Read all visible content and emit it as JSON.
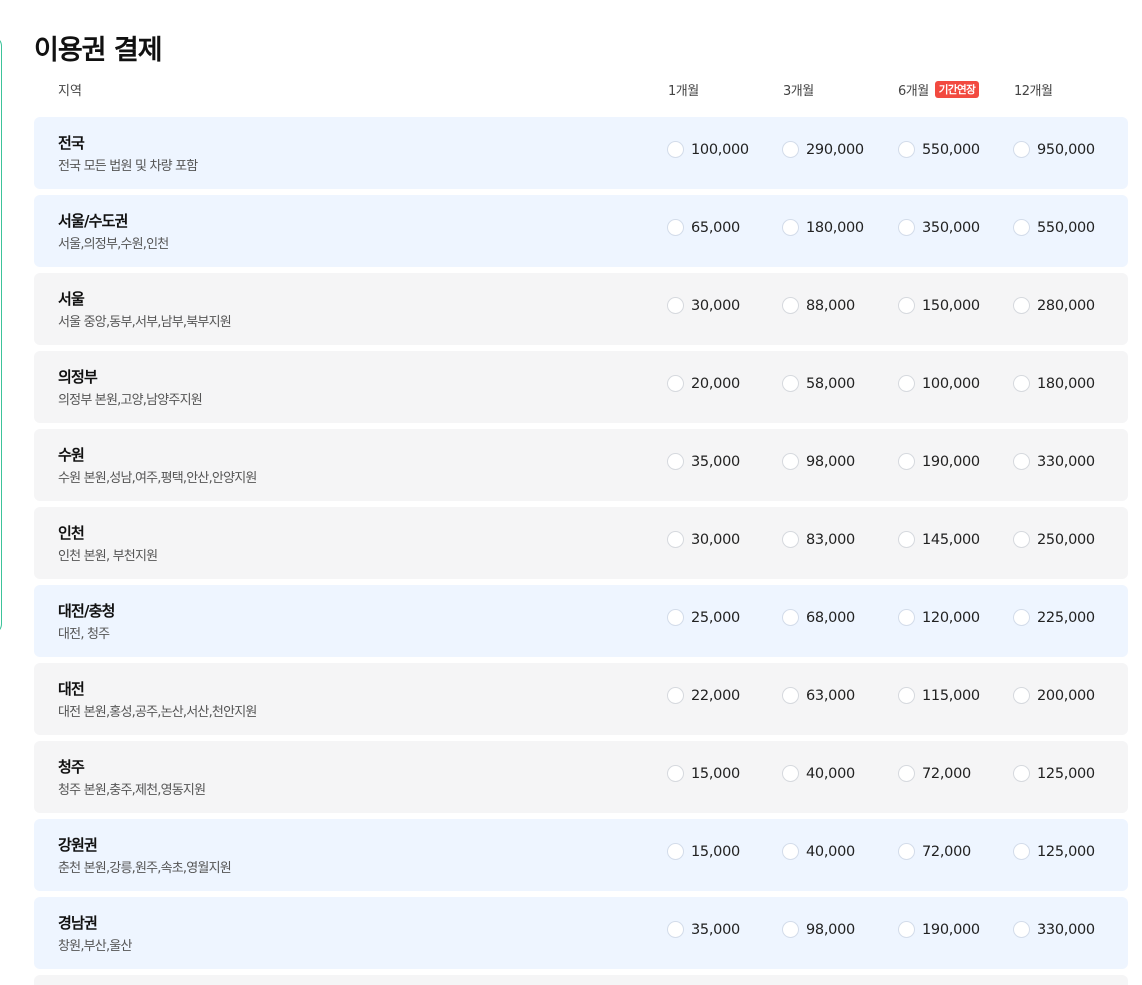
{
  "page": {
    "title": "이용권 결제"
  },
  "columns": {
    "region": "지역",
    "periods": [
      "1개월",
      "3개월",
      "6개월",
      "12개월"
    ],
    "badge": "기간연장"
  },
  "rows": [
    {
      "name": "전국",
      "desc": "전국 모든 법원 및 차량 포함",
      "prices": [
        "100,000",
        "290,000",
        "550,000",
        "950,000"
      ],
      "highlight": true
    },
    {
      "name": "서울/수도권",
      "desc": "서울,의정부,수원,인천",
      "prices": [
        "65,000",
        "180,000",
        "350,000",
        "550,000"
      ],
      "highlight": true
    },
    {
      "name": "서울",
      "desc": "서울 중앙,동부,서부,남부,북부지원",
      "prices": [
        "30,000",
        "88,000",
        "150,000",
        "280,000"
      ],
      "highlight": false
    },
    {
      "name": "의정부",
      "desc": "의정부 본원,고양,남양주지원",
      "prices": [
        "20,000",
        "58,000",
        "100,000",
        "180,000"
      ],
      "highlight": false
    },
    {
      "name": "수원",
      "desc": "수원 본원,성남,여주,평택,안산,안양지원",
      "prices": [
        "35,000",
        "98,000",
        "190,000",
        "330,000"
      ],
      "highlight": false
    },
    {
      "name": "인천",
      "desc": "인천 본원, 부천지원",
      "prices": [
        "30,000",
        "83,000",
        "145,000",
        "250,000"
      ],
      "highlight": false
    },
    {
      "name": "대전/충청",
      "desc": "대전, 청주",
      "prices": [
        "25,000",
        "68,000",
        "120,000",
        "225,000"
      ],
      "highlight": true
    },
    {
      "name": "대전",
      "desc": "대전 본원,홍성,공주,논산,서산,천안지원",
      "prices": [
        "22,000",
        "63,000",
        "115,000",
        "200,000"
      ],
      "highlight": false
    },
    {
      "name": "청주",
      "desc": "청주 본원,충주,제천,영동지원",
      "prices": [
        "15,000",
        "40,000",
        "72,000",
        "125,000"
      ],
      "highlight": false
    },
    {
      "name": "강원권",
      "desc": "춘천 본원,강릉,원주,속초,영월지원",
      "prices": [
        "15,000",
        "40,000",
        "72,000",
        "125,000"
      ],
      "highlight": true
    },
    {
      "name": "경남권",
      "desc": "창원,부산,울산",
      "prices": [
        "35,000",
        "98,000",
        "190,000",
        "330,000"
      ],
      "highlight": true
    }
  ]
}
